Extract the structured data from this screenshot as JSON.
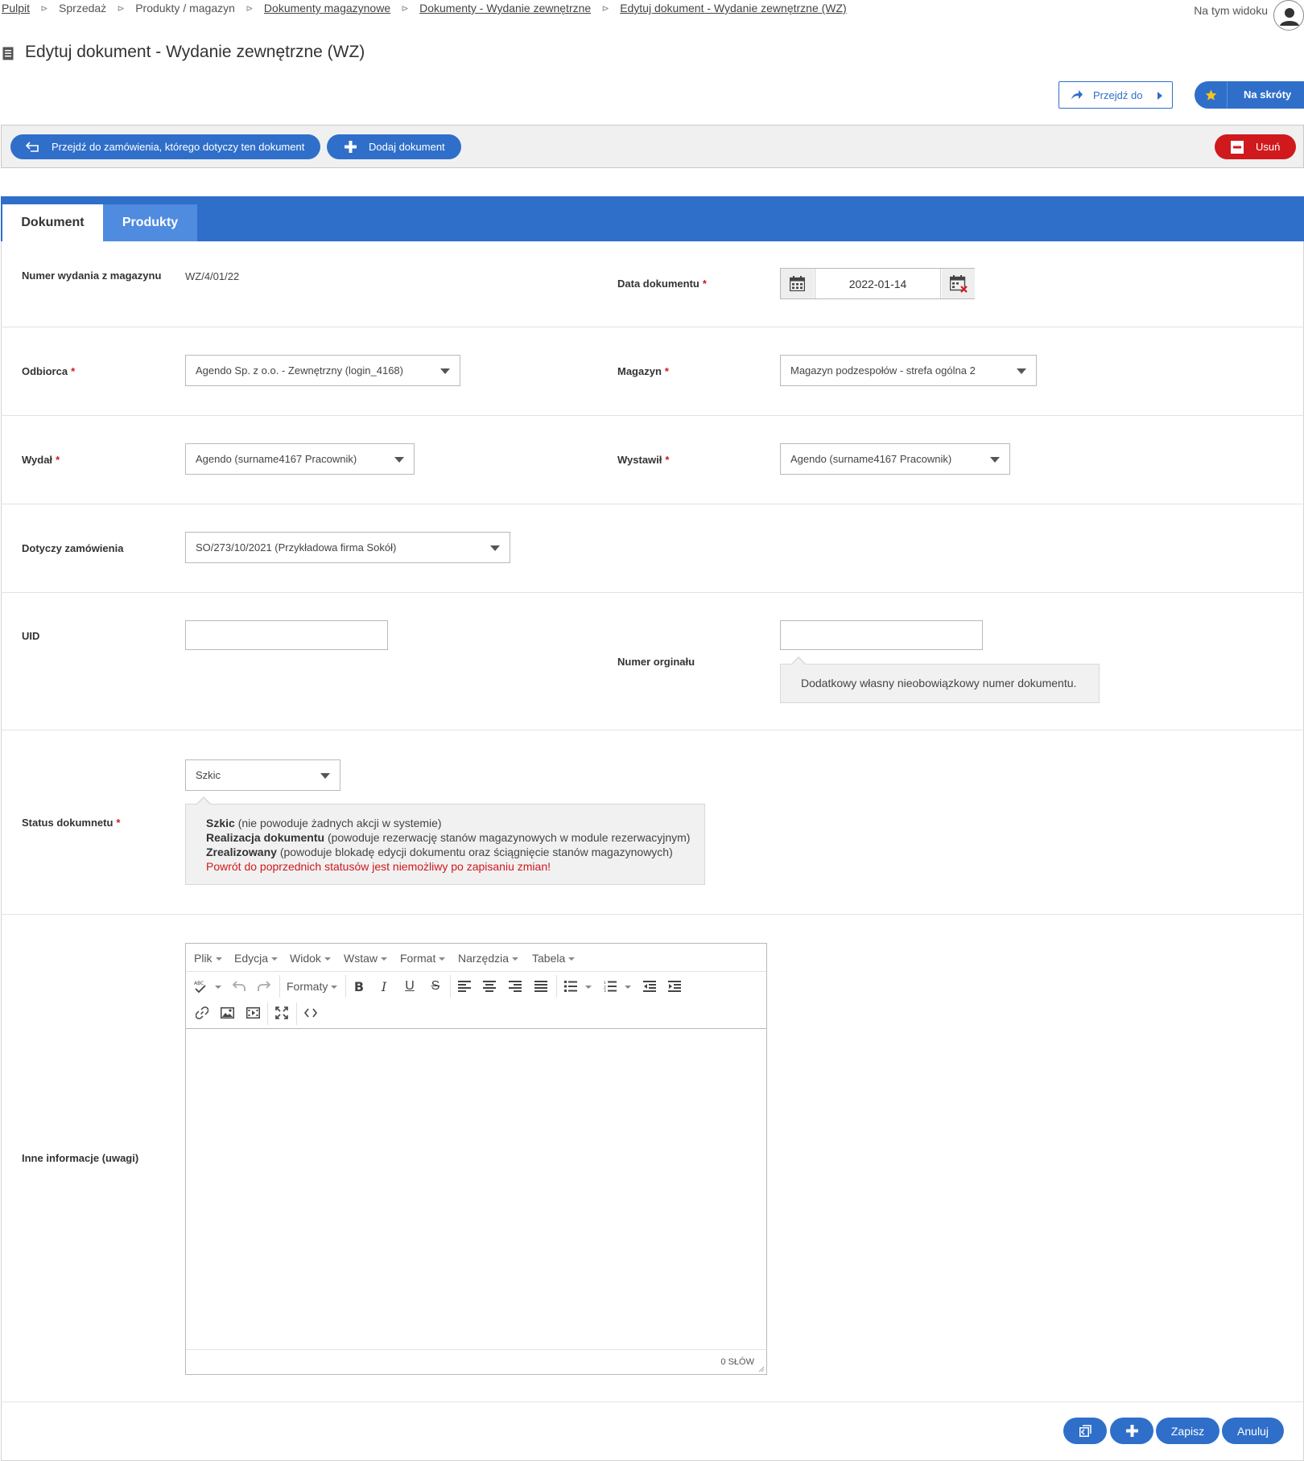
{
  "breadcrumb": {
    "items": [
      "Pulpit",
      "Sprzedaż",
      "Produkty / magazyn",
      "Dokumenty magazynowe",
      "Dokumenty - Wydanie zewnętrzne",
      "Edytuj dokument - Wydanie zewnętrzne (WZ)"
    ],
    "separator": "⊳"
  },
  "header": {
    "view_label": "Na tym widoku",
    "page_title": "Edytuj dokument - Wydanie zewnętrzne (WZ)"
  },
  "top_buttons": {
    "goto_label": "Przejdź do",
    "shortcuts_label": "Na skróty"
  },
  "action_bar": {
    "goto_order_label": "Przejdź do zamówienia, którego dotyczy ten dokument",
    "add_document_label": "Dodaj dokument",
    "delete_label": "Usuń"
  },
  "tabs": [
    {
      "label": "Dokument",
      "active": true
    },
    {
      "label": "Produkty",
      "active": false
    }
  ],
  "form": {
    "issue_number": {
      "label": "Numer wydania z magazynu",
      "value": "WZ/4/01/22"
    },
    "document_date": {
      "label": "Data dokumentu",
      "value": "2022-01-14"
    },
    "recipient": {
      "label": "Odbiorca",
      "value": "Agendo Sp. z o.o. - Zewnętrzny (login_4168)"
    },
    "warehouse": {
      "label": "Magazyn",
      "value": "Magazyn podzespołów - strefa ogólna 2"
    },
    "issued_by": {
      "label": "Wydał",
      "value": "Agendo (surname4167 Pracownik)"
    },
    "created_by": {
      "label": "Wystawił",
      "value": "Agendo (surname4167 Pracownik)"
    },
    "related_order": {
      "label": "Dotyczy zamówienia",
      "value": "SO/273/10/2021 (Przykładowa firma Sokół)"
    },
    "uid": {
      "label": "UID",
      "value": ""
    },
    "original_number": {
      "label": "Numer orginału",
      "value": "",
      "hint": "Dodatkowy własny nieobowiązkowy numer dokumentu."
    },
    "status": {
      "label": "Status dokumnetu",
      "value": "Szkic",
      "hint": {
        "draft_name": "Szkic",
        "draft_desc": "(nie powoduje żadnych akcji w systemie)",
        "realization_name": "Realizacja dokumentu",
        "realization_desc": "(powoduje rezerwację stanów magazynowych w module rezerwacyjnym)",
        "done_name": "Zrealizowany",
        "done_desc": "(powoduje blokadę edycji dokumentu oraz ściągnięcie stanów magazynowych)",
        "warning": "Powrót do poprzednich statusów jest niemożliwy po zapisaniu zmian!"
      }
    },
    "notes": {
      "label": "Inne informacje (uwagi)"
    }
  },
  "editor": {
    "menu": [
      "Plik",
      "Edycja",
      "Widok",
      "Wstaw",
      "Format",
      "Narzędzia",
      "Tabela"
    ],
    "formats_label": "Formaty",
    "word_count": "0 SŁÓW"
  },
  "bottom_buttons": {
    "save_label": "Zapisz",
    "cancel_label": "Anuluj"
  },
  "colors": {
    "primary": "#2f6fca",
    "danger": "#d0191c",
    "star": "#f5c518"
  }
}
